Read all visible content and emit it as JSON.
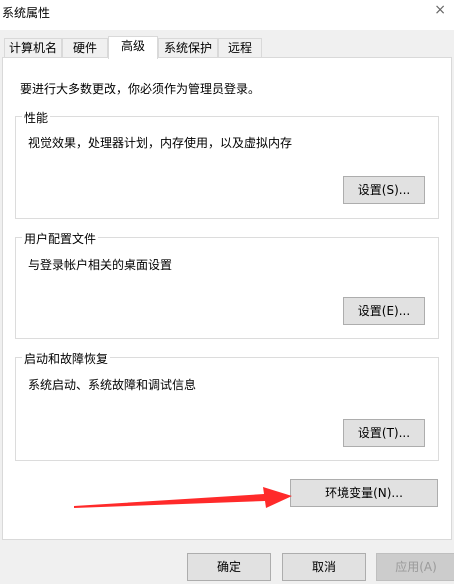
{
  "window": {
    "title": "系统属性"
  },
  "tabs": [
    {
      "label": "计算机名"
    },
    {
      "label": "硬件"
    },
    {
      "label": "高级",
      "active": true
    },
    {
      "label": "系统保护"
    },
    {
      "label": "远程"
    }
  ],
  "advanced": {
    "admin_notice": "要进行大多数更改，你必须作为管理员登录。",
    "performance": {
      "title": "性能",
      "description": "视觉效果，处理器计划，内存使用，以及虚拟内存",
      "button": "设置(S)..."
    },
    "user_profiles": {
      "title": "用户配置文件",
      "description": "与登录帐户相关的桌面设置",
      "button": "设置(E)..."
    },
    "startup_recovery": {
      "title": "启动和故障恢复",
      "description": "系统启动、系统故障和调试信息",
      "button": "设置(T)..."
    },
    "env_vars_button": "环境变量(N)..."
  },
  "footer": {
    "ok": "确定",
    "cancel": "取消",
    "apply": "应用(A)"
  },
  "annotation": {
    "arrow_color": "#ff2a2a"
  }
}
